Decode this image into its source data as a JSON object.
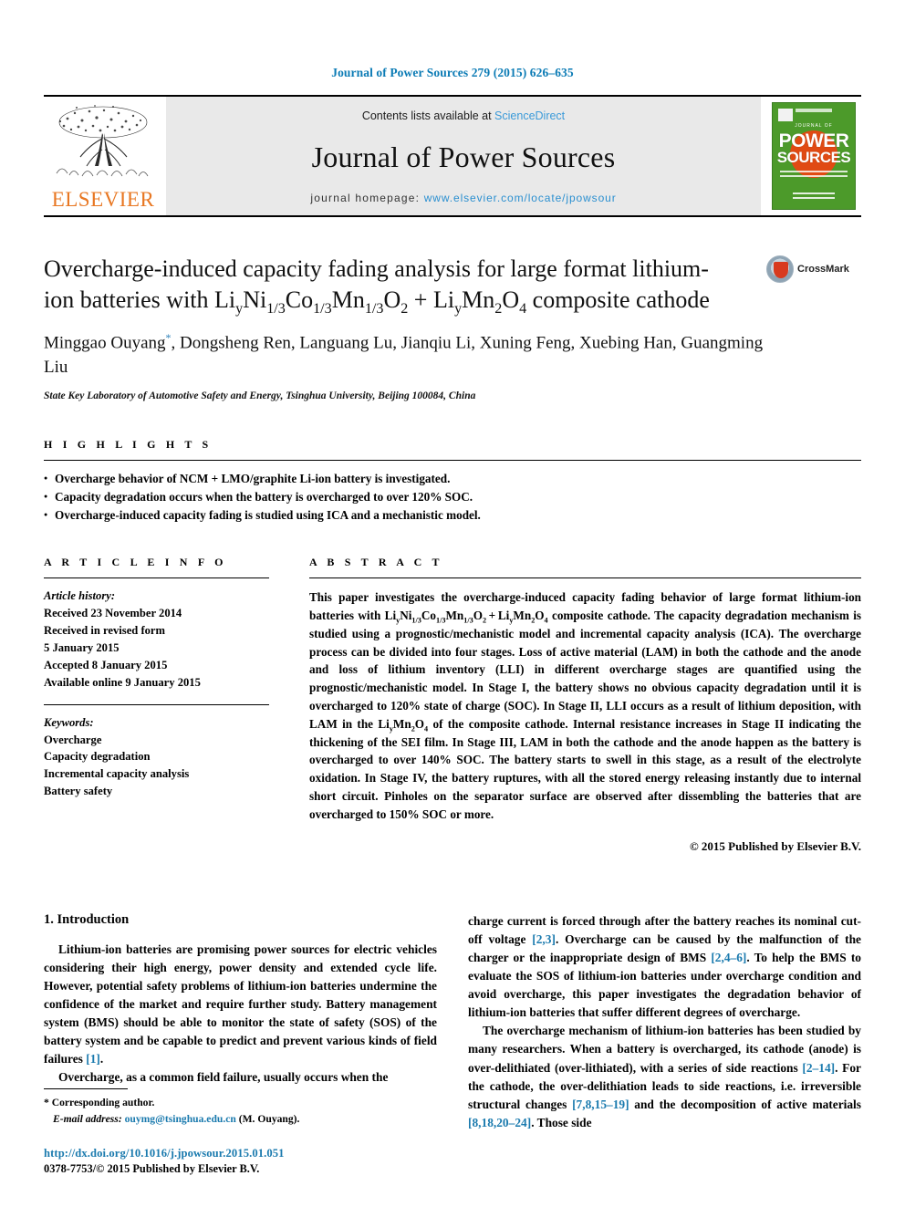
{
  "running_head": "Journal of Power Sources 279 (2015) 626–635",
  "masthead": {
    "contents_prefix": "Contents lists available at ",
    "contents_link": "ScienceDirect",
    "journal_name": "Journal of Power Sources",
    "homepage_prefix": "journal homepage: ",
    "homepage_url": "www.elsevier.com/locate/jpowsour",
    "publisher": "ELSEVIER",
    "cover": {
      "line1": "JOURNAL OF",
      "line2": "POWER",
      "line3": "SOURCES"
    }
  },
  "article": {
    "title_line1": "Overcharge-induced capacity fading analysis for large format",
    "title_line2_pre": "lithium-ion batteries with Li",
    "title_full": "Overcharge-induced capacity fading analysis for large format lithium-ion batteries with LiyNi1/3Co1/3Mn1/3O2 + LiyMn2O4 composite cathode",
    "crossmark_label": "CrossMark",
    "authors": "Minggao Ouyang, Dongsheng Ren, Languang Lu, Jianqiu Li, Xuning Feng, Xuebing Han, Guangming Liu",
    "affiliation": "State Key Laboratory of Automotive Safety and Energy, Tsinghua University, Beijing 100084, China"
  },
  "highlights": {
    "heading": "H I G H L I G H T S",
    "items": [
      "Overcharge behavior of NCM + LMO/graphite Li-ion battery is investigated.",
      "Capacity degradation occurs when the battery is overcharged to over 120% SOC.",
      "Overcharge-induced capacity fading is studied using ICA and a mechanistic model."
    ]
  },
  "article_info": {
    "heading": "A R T I C L E    I N F O",
    "history_label": "Article history:",
    "history": [
      "Received 23 November 2014",
      "Received in revised form",
      "5 January 2015",
      "Accepted 8 January 2015",
      "Available online 9 January 2015"
    ],
    "keywords_label": "Keywords:",
    "keywords": [
      "Overcharge",
      "Capacity degradation",
      "Incremental capacity analysis",
      "Battery safety"
    ]
  },
  "abstract": {
    "heading": "A B S T R A C T",
    "text": "This paper investigates the overcharge-induced capacity fading behavior of large format lithium-ion batteries with LiyNi1/3Co1/3Mn1/3O2 + LiyMn2O4 composite cathode. The capacity degradation mechanism is studied using a prognostic/mechanistic model and incremental capacity analysis (ICA). The overcharge process can be divided into four stages. Loss of active material (LAM) in both the cathode and the anode and loss of lithium inventory (LLI) in different overcharge stages are quantified using the prognostic/mechanistic model. In Stage I, the battery shows no obvious capacity degradation until it is overcharged to 120% state of charge (SOC). In Stage II, LLI occurs as a result of lithium deposition, with LAM in the LiyMn2O4 of the composite cathode. Internal resistance increases in Stage II indicating the thickening of the SEI film. In Stage III, LAM in both the cathode and the anode happen as the battery is overcharged to over 140% SOC. The battery starts to swell in this stage, as a result of the electrolyte oxidation. In Stage IV, the battery ruptures, with all the stored energy releasing instantly due to internal short circuit. Pinholes on the separator surface are observed after dissembling the batteries that are overcharged to 150% SOC or more.",
    "copyright": "© 2015 Published by Elsevier B.V."
  },
  "introduction": {
    "heading": "1. Introduction",
    "left_para_1": "Lithium-ion batteries are promising power sources for electric vehicles considering their high energy, power density and extended cycle life. However, potential safety problems of lithium-ion batteries undermine the confidence of the market and require further study. Battery management system (BMS) should be able to monitor the state of safety (SOS) of the battery system and be capable to predict and prevent various kinds of field failures [1].",
    "left_para_2": "Overcharge, as a common field failure, usually occurs when the",
    "right_para_1": "charge current is forced through after the battery reaches its nominal cut-off voltage [2,3]. Overcharge can be caused by the malfunction of the charger or the inappropriate design of BMS [2,4–6]. To help the BMS to evaluate the SOS of lithium-ion batteries under overcharge condition and avoid overcharge, this paper investigates the degradation behavior of lithium-ion batteries that suffer different degrees of overcharge.",
    "right_para_2": "The overcharge mechanism of lithium-ion batteries has been studied by many researchers. When a battery is overcharged, its cathode (anode) is over-delithiated (over-lithiated), with a series of side reactions [2–14]. For the cathode, the over-delithiation leads to side reactions, i.e. irreversible structural changes [7,8,15–19] and the decomposition of active materials [8,18,20–24]. Those side"
  },
  "footer": {
    "corresponding": "* Corresponding author.",
    "email_label": "E-mail address:",
    "email": "ouymg@tsinghua.edu.cn",
    "email_suffix": "(M. Ouyang).",
    "doi": "http://dx.doi.org/10.1016/j.jpowsour.2015.01.051",
    "issn": "0378-7753/© 2015 Published by Elsevier B.V."
  },
  "colors": {
    "link_blue": "#1a7aae",
    "sciencedirect_blue": "#3a9ad9",
    "elsevier_orange": "#e87722",
    "cover_green": "#4c9a2a"
  }
}
